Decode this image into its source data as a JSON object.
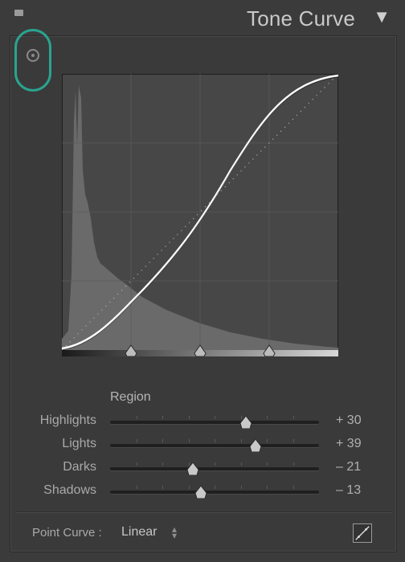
{
  "panel": {
    "title": "Tone Curve",
    "disclosure_icon": "triangle-down-icon",
    "collapse_icon": "collapse-square-icon"
  },
  "target_tool": {
    "icon": "target-adjustment-icon",
    "highlight_color": "#2aa48f"
  },
  "curve": {
    "colors": {
      "background": "#474747",
      "histogram": "#6a6a6a",
      "curve": "#ffffff",
      "grid": "#565656"
    },
    "split_points": [
      0.25,
      0.5,
      0.75
    ]
  },
  "region": {
    "label": "Region",
    "sliders": [
      {
        "name": "Highlights",
        "value_text": "+ 30",
        "value": 30
      },
      {
        "name": "Lights",
        "value_text": "+ 39",
        "value": 39
      },
      {
        "name": "Darks",
        "value_text": "– 21",
        "value": -21
      },
      {
        "name": "Shadows",
        "value_text": "– 13",
        "value": -13
      }
    ],
    "range": [
      -100,
      100
    ]
  },
  "point_curve": {
    "label": "Point Curve :",
    "value": "Linear",
    "spin_icon": "up-down-spinner-icon",
    "button_icon": "curve-edit-icon"
  }
}
